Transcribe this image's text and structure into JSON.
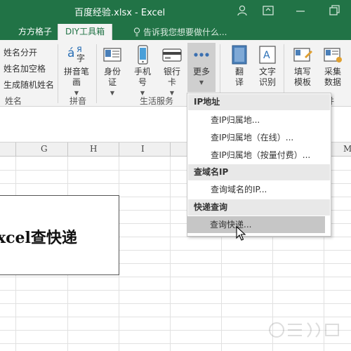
{
  "window": {
    "title": "百度经验.xlsx - Excel"
  },
  "tabs": [
    {
      "label": "方方格子"
    },
    {
      "label": "DIY工具箱"
    }
  ],
  "tell_me": "告诉我您想要做什么...",
  "ribbon": {
    "name_group": {
      "items": [
        "姓名分开",
        "姓名加空格",
        "生成随机姓名"
      ],
      "label": "姓名"
    },
    "pinyin_group": {
      "button_lines": [
        "拼音笔",
        "画"
      ],
      "icon_text": [
        "á",
        "я",
        "字"
      ],
      "label": "拼音"
    },
    "life_group": {
      "buttons": [
        {
          "lines": [
            "身份",
            "证"
          ]
        },
        {
          "lines": [
            "手机",
            "号"
          ]
        },
        {
          "lines": [
            "银行",
            "卡"
          ]
        },
        {
          "lines": [
            "更多"
          ]
        }
      ],
      "label": "生活服务"
    },
    "other_buttons": [
      {
        "lines": [
          "翻",
          "译"
        ]
      },
      {
        "lines": [
          "文字",
          "识别"
        ]
      },
      {
        "lines": [
          "填写",
          "模板"
        ]
      },
      {
        "lines": [
          "采集",
          "数据"
        ]
      }
    ],
    "partial_group_label": "并"
  },
  "columns": [
    "G",
    "H",
    "I",
    "M"
  ],
  "textbox": {
    "text": "xcel查快递"
  },
  "dropdown": {
    "sections": [
      {
        "title": "IP地址",
        "items": [
          "查IP归属地...",
          "查IP归属地（在线）...",
          "查IP归属地（按量付费）..."
        ]
      },
      {
        "title": "查域名IP",
        "items": [
          "查询域名的IP..."
        ]
      },
      {
        "title": "快递查询",
        "items": [
          "查询快递..."
        ]
      }
    ],
    "hovered_item": "查询快递..."
  },
  "colors": {
    "excel_green": "#217346",
    "ribbon_bg": "#f3f3f3",
    "menu_hover": "#c6c6c6"
  }
}
